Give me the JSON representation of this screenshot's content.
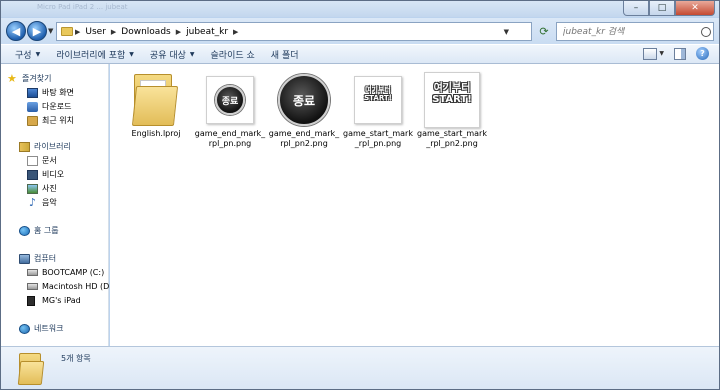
{
  "window": {
    "ghost_title": "Micro Pad iPad 2 ... jubeat",
    "minimize": "–",
    "maximize": "□",
    "close": "✕"
  },
  "address_bar": {
    "crumbs": [
      "User",
      "Downloads",
      "jubeat_kr"
    ],
    "search_placeholder": "jubeat_kr 검색"
  },
  "toolbar": {
    "items": [
      {
        "label": "구성",
        "has_menu": true
      },
      {
        "label": "라이브러리에 포함",
        "has_menu": true
      },
      {
        "label": "공유 대상",
        "has_menu": true
      },
      {
        "label": "슬라이드 쇼",
        "has_menu": false
      },
      {
        "label": "새 폴더",
        "has_menu": false
      }
    ]
  },
  "nav": {
    "favorites": "즐겨찾기",
    "desktop": "바탕 화면",
    "downloads": "다운로드",
    "recent": "최근 위치",
    "libraries": "라이브러리",
    "documents": "문서",
    "videos": "비디오",
    "pictures": "사진",
    "music": "음악",
    "homegroup": "홈 그룹",
    "computer": "컴퓨터",
    "bootcamp": "BOOTCAMP (C:)",
    "macintosh": "Macintosh HD (D:)",
    "ipad": "MG's iPad",
    "network": "네트워크"
  },
  "files": [
    {
      "name": "English.lproj",
      "kind": "folder"
    },
    {
      "name": "game_end_mark_rpl_pn.png",
      "kind": "image",
      "thumb_text": "종료"
    },
    {
      "name": "game_end_mark_rpl_pn2.png",
      "kind": "image",
      "thumb_text": "종료"
    },
    {
      "name": "game_start_mark_rpl_pn.png",
      "kind": "image",
      "thumb_text_line1": "여기부터",
      "thumb_text_line2": "START!"
    },
    {
      "name": "game_start_mark_rpl_pn2.png",
      "kind": "image",
      "thumb_text_line1": "여기부터",
      "thumb_text_line2": "START!"
    }
  ],
  "status": {
    "item_count": "5개 항목"
  },
  "colors": {
    "chrome": "#bcd3ee",
    "nav_text": "#1e395b",
    "close_button": "#c44a32"
  }
}
